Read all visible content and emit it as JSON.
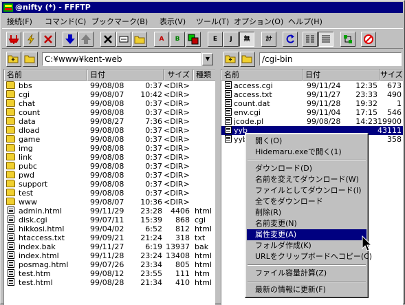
{
  "title": "@nifty (*) - FFFTP",
  "menu": [
    "接続(F)",
    "コマンド(C)",
    "ブックマーク(B)",
    "表示(V)",
    "ツール(T)",
    "オプション(O)",
    "ヘルプ(H)"
  ],
  "toolbar": [
    {
      "icon": "connect-icon",
      "label": ""
    },
    {
      "icon": "quick-connect-icon",
      "label": ""
    },
    {
      "icon": "disconnect-icon",
      "label": ""
    },
    {
      "icon": "download-icon",
      "label": ""
    },
    {
      "icon": "upload-icon",
      "label": ""
    },
    {
      "icon": "delete-icon",
      "label": ""
    },
    {
      "icon": "rename-icon",
      "label": ""
    },
    {
      "icon": "mkdir-icon",
      "label": ""
    },
    {
      "icon": "ascii-mode-icon",
      "label": "A"
    },
    {
      "icon": "binary-mode-icon",
      "label": "B"
    },
    {
      "icon": "auto-mode-icon",
      "label": ""
    },
    {
      "icon": "euc-icon",
      "label": "E"
    },
    {
      "icon": "jis-icon",
      "label": "J"
    },
    {
      "icon": "no-convert-icon",
      "label": "無"
    },
    {
      "icon": "kana-icon",
      "label": "ｶﾅ"
    },
    {
      "icon": "refresh-icon",
      "label": ""
    },
    {
      "icon": "list-view-icon",
      "label": ""
    },
    {
      "icon": "detail-view-icon",
      "label": ""
    },
    {
      "icon": "sync-icon",
      "label": ""
    },
    {
      "icon": "stop-icon",
      "label": ""
    }
  ],
  "local": {
    "path": "C:¥www¥kent-web",
    "columns": [
      "名前",
      "日付",
      "サイズ",
      "種類"
    ],
    "rows": [
      {
        "type": "folder",
        "name": "bbs",
        "date": "99/08/08",
        "time": "0:37",
        "size": "<DIR>",
        "kind": ""
      },
      {
        "type": "folder",
        "name": "cgi",
        "date": "99/08/07",
        "time": "10:42",
        "size": "<DIR>",
        "kind": ""
      },
      {
        "type": "folder",
        "name": "chat",
        "date": "99/08/08",
        "time": "0:37",
        "size": "<DIR>",
        "kind": ""
      },
      {
        "type": "folder",
        "name": "count",
        "date": "99/08/08",
        "time": "0:37",
        "size": "<DIR>",
        "kind": ""
      },
      {
        "type": "folder",
        "name": "data",
        "date": "99/08/27",
        "time": "7:36",
        "size": "<DIR>",
        "kind": ""
      },
      {
        "type": "folder",
        "name": "dload",
        "date": "99/08/08",
        "time": "0:37",
        "size": "<DIR>",
        "kind": ""
      },
      {
        "type": "folder",
        "name": "game",
        "date": "99/08/08",
        "time": "0:37",
        "size": "<DIR>",
        "kind": ""
      },
      {
        "type": "folder",
        "name": "img",
        "date": "99/08/08",
        "time": "0:37",
        "size": "<DIR>",
        "kind": ""
      },
      {
        "type": "folder",
        "name": "link",
        "date": "99/08/08",
        "time": "0:37",
        "size": "<DIR>",
        "kind": ""
      },
      {
        "type": "folder",
        "name": "pubc",
        "date": "99/08/08",
        "time": "0:37",
        "size": "<DIR>",
        "kind": ""
      },
      {
        "type": "folder",
        "name": "pwd",
        "date": "99/08/08",
        "time": "0:37",
        "size": "<DIR>",
        "kind": ""
      },
      {
        "type": "folder",
        "name": "support",
        "date": "99/08/08",
        "time": "0:37",
        "size": "<DIR>",
        "kind": ""
      },
      {
        "type": "folder",
        "name": "test",
        "date": "99/08/08",
        "time": "0:37",
        "size": "<DIR>",
        "kind": ""
      },
      {
        "type": "folder",
        "name": "www",
        "date": "99/08/07",
        "time": "10:36",
        "size": "<DIR>",
        "kind": ""
      },
      {
        "type": "file",
        "name": "admin.html",
        "date": "99/11/29",
        "time": "23:28",
        "size": "4406",
        "kind": "html"
      },
      {
        "type": "file",
        "name": "disk.cgi",
        "date": "99/07/11",
        "time": "15:39",
        "size": "868",
        "kind": "cgi"
      },
      {
        "type": "file",
        "name": "hikkosi.html",
        "date": "99/04/02",
        "time": "6:52",
        "size": "812",
        "kind": "html"
      },
      {
        "type": "file",
        "name": "htaccess.txt",
        "date": "99/09/21",
        "time": "21:24",
        "size": "318",
        "kind": "txt"
      },
      {
        "type": "file",
        "name": "index.bak",
        "date": "99/11/27",
        "time": "6:19",
        "size": "13937",
        "kind": "bak"
      },
      {
        "type": "file",
        "name": "index.html",
        "date": "99/11/28",
        "time": "23:24",
        "size": "13408",
        "kind": "html"
      },
      {
        "type": "file",
        "name": "posmag.html",
        "date": "99/07/26",
        "time": "23:34",
        "size": "805",
        "kind": "html"
      },
      {
        "type": "file",
        "name": "test.htm",
        "date": "99/08/12",
        "time": "23:55",
        "size": "111",
        "kind": "htm"
      },
      {
        "type": "file",
        "name": "test.html",
        "date": "99/08/28",
        "time": "21:34",
        "size": "410",
        "kind": "html"
      }
    ]
  },
  "remote": {
    "path": "/cgi-bin",
    "columns": [
      "名前",
      "日付",
      "サイズ"
    ],
    "rows": [
      {
        "name": "access.cgi",
        "date": "99/11/24",
        "time": "12:35",
        "size": "673",
        "selected": false
      },
      {
        "name": "access.txt",
        "date": "99/11/27",
        "time": "23:33",
        "size": "490",
        "selected": false
      },
      {
        "name": "count.dat",
        "date": "99/11/28",
        "time": "19:32",
        "size": "1",
        "selected": false
      },
      {
        "name": "env.cgi",
        "date": "99/11/04",
        "time": "17:15",
        "size": "546",
        "selected": false
      },
      {
        "name": "jcode.pl",
        "date": "99/08/28",
        "time": "14:23",
        "size": "19900",
        "selected": false
      },
      {
        "name": "yyb",
        "date": "",
        "time": "",
        "size": "43111",
        "selected": true
      },
      {
        "name": "yyb",
        "date": "",
        "time": "",
        "size": "358",
        "selected": false
      }
    ]
  },
  "context_menu": [
    {
      "label": "開く(O)",
      "highlight": false
    },
    {
      "label": "Hidemaru.exeで開く(1)",
      "highlight": false
    },
    {
      "sep": true
    },
    {
      "label": "ダウンロード(D)",
      "highlight": false
    },
    {
      "label": "名前を変えてダウンロード(W)",
      "highlight": false
    },
    {
      "label": "ファイルとしてダウンロード(I)",
      "highlight": false
    },
    {
      "label": "全てをダウンロード",
      "highlight": false
    },
    {
      "label": "削除(R)",
      "highlight": false
    },
    {
      "label": "名前変更(N)",
      "highlight": false
    },
    {
      "label": "属性変更(A)",
      "highlight": true
    },
    {
      "label": "フォルダ作成(K)",
      "highlight": false
    },
    {
      "label": "URLをクリップボードへコピー(C)",
      "highlight": false
    },
    {
      "sep": true
    },
    {
      "label": "ファイル容量計算(Z)",
      "highlight": false
    },
    {
      "sep": true
    },
    {
      "label": "最新の情報に更新(F)",
      "highlight": false
    }
  ],
  "colors": {
    "titlebar": "#000080",
    "selection": "#000080",
    "folder": "#f0d030"
  }
}
